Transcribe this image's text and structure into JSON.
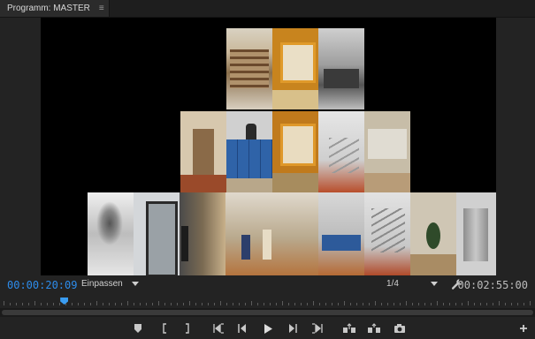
{
  "panel": {
    "tab_title": "Programm: MASTER",
    "tab_menu_icon": "hamburger-menu-icon"
  },
  "monitor": {
    "current_timecode": "00:00:20:09",
    "duration_timecode": "00:02:55:00",
    "fit_option": "Einpassen",
    "resolution_option": "1/4",
    "settings_icon": "wrench-icon"
  },
  "playhead": {
    "fraction_of_ruler": 0.115
  },
  "transport_icons": [
    "add-marker-icon",
    "mark-in-icon",
    "mark-out-icon",
    "go-to-in-icon",
    "step-back-icon",
    "play-icon",
    "step-forward-icon",
    "go-to-out-icon",
    "lift-icon",
    "extract-icon",
    "export-frame-icon",
    "button-editor-icon"
  ],
  "colors": {
    "accent_blue": "#2d8ceb",
    "panel_bg": "#232323",
    "video_bg": "#000000"
  }
}
